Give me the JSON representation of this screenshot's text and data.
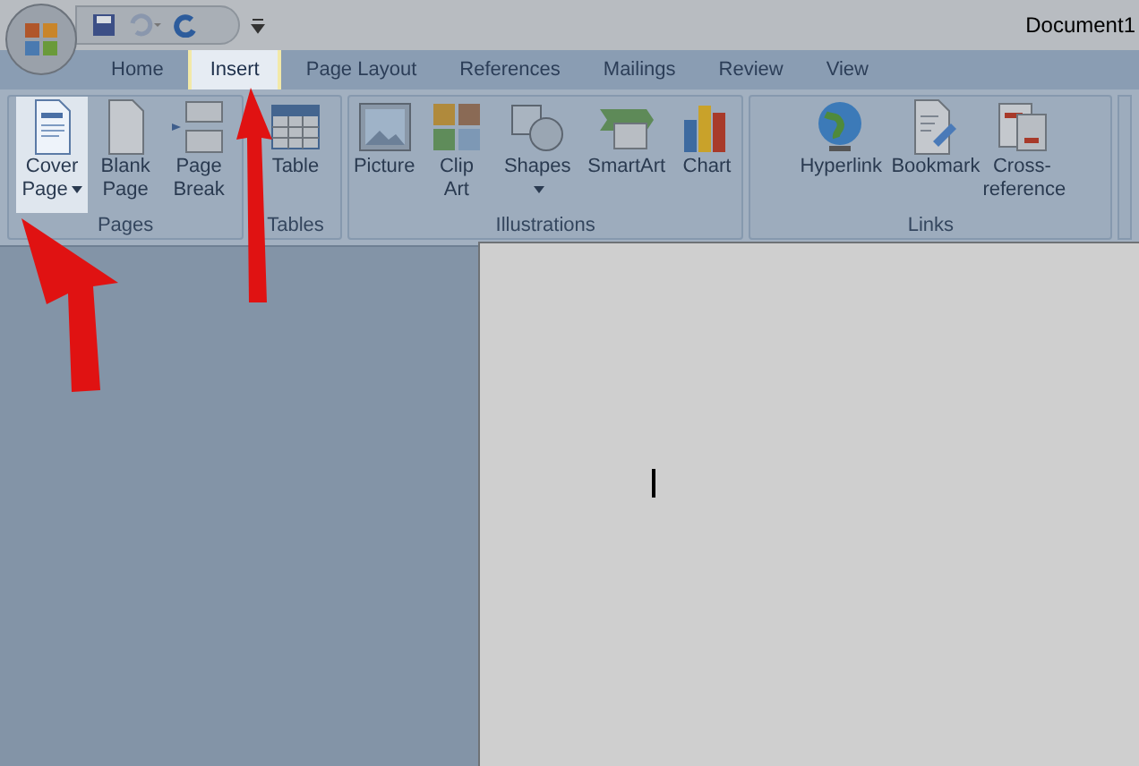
{
  "window": {
    "title": "Document1"
  },
  "tabs": [
    {
      "label": "Home",
      "selected": false
    },
    {
      "label": "Insert",
      "selected": true
    },
    {
      "label": "Page Layout",
      "selected": false
    },
    {
      "label": "References",
      "selected": false
    },
    {
      "label": "Mailings",
      "selected": false
    },
    {
      "label": "Review",
      "selected": false
    },
    {
      "label": "View",
      "selected": false
    }
  ],
  "ribbon_groups": [
    {
      "label": "Pages",
      "buttons": [
        {
          "label": "Cover Page",
          "dropdown": true,
          "highlighted": true
        },
        {
          "label": "Blank Page",
          "dropdown": false,
          "highlighted": false
        },
        {
          "label": "Page Break",
          "dropdown": false,
          "highlighted": false
        }
      ]
    },
    {
      "label": "Tables",
      "buttons": [
        {
          "label": "Table",
          "dropdown": false,
          "highlighted": false
        }
      ]
    },
    {
      "label": "Illustrations",
      "buttons": [
        {
          "label": "Picture",
          "dropdown": false,
          "highlighted": false
        },
        {
          "label": "Clip Art",
          "dropdown": false,
          "highlighted": false
        },
        {
          "label": "Shapes",
          "dropdown": true,
          "highlighted": false
        },
        {
          "label": "SmartArt",
          "dropdown": false,
          "highlighted": false
        },
        {
          "label": "Chart",
          "dropdown": false,
          "highlighted": false
        }
      ]
    },
    {
      "label": "Links",
      "buttons": [
        {
          "label": "Hyperlink",
          "dropdown": false,
          "highlighted": false
        },
        {
          "label": "Bookmark",
          "dropdown": false,
          "highlighted": false
        },
        {
          "label": "Cross-reference",
          "dropdown": false,
          "highlighted": false
        }
      ]
    }
  ]
}
